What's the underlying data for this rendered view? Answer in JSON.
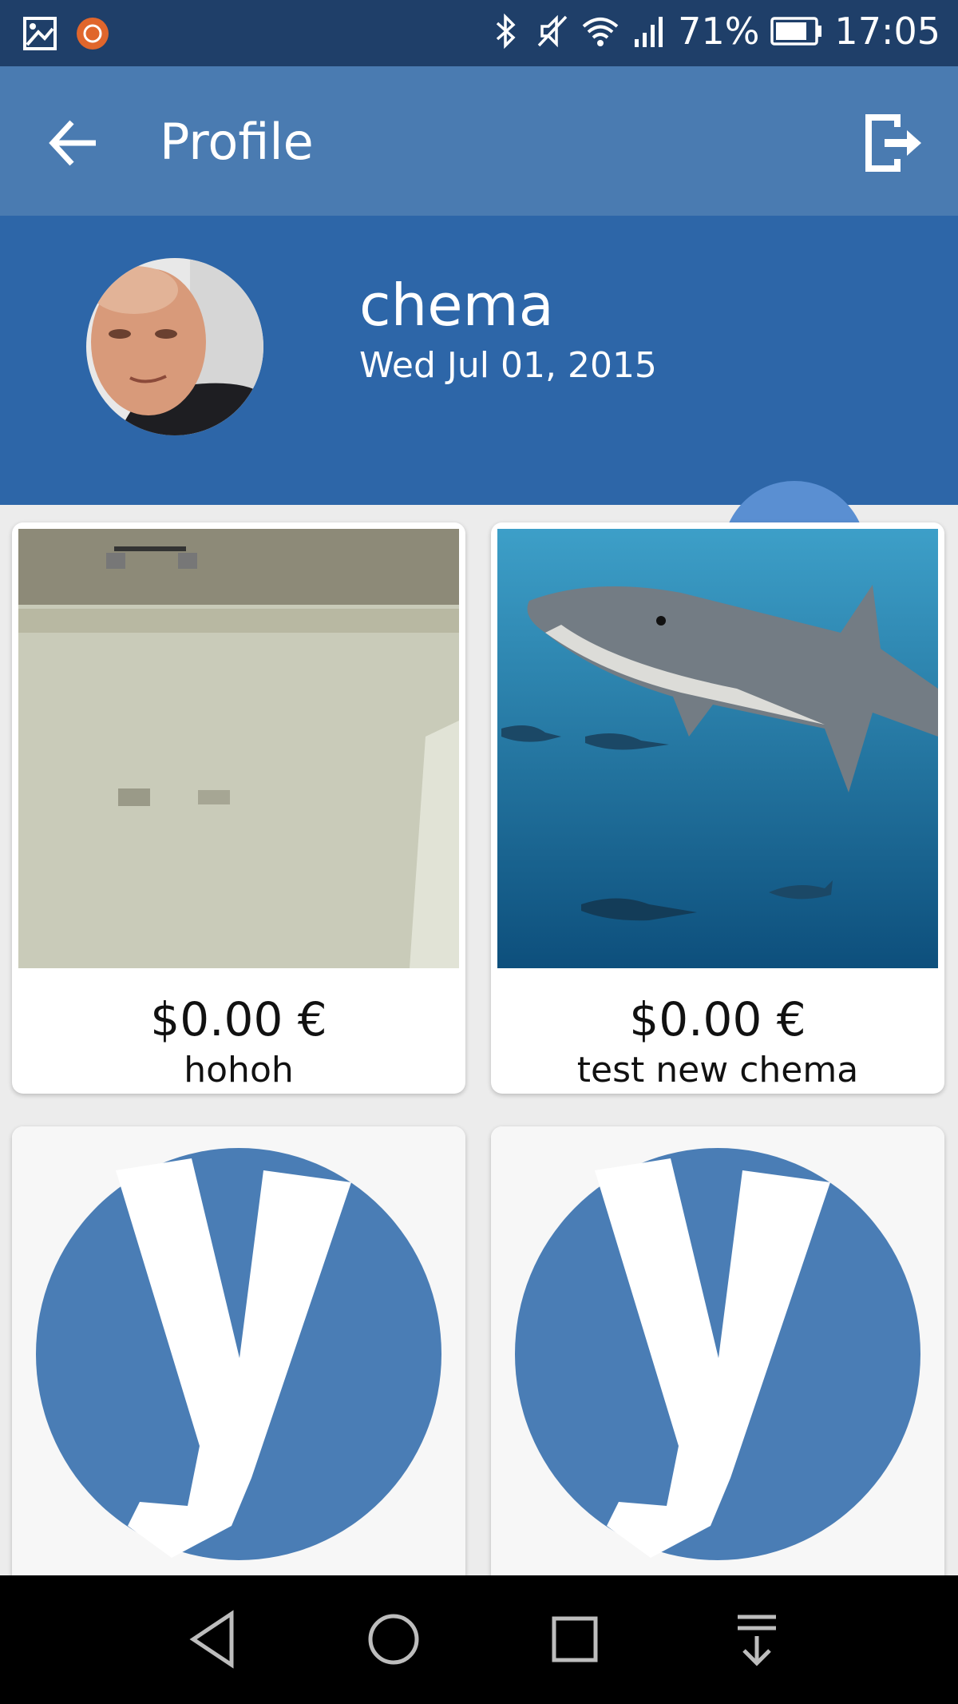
{
  "status_bar": {
    "battery": "71%",
    "time": "17:05"
  },
  "app_bar": {
    "title": "Profile"
  },
  "profile": {
    "username": "chema",
    "join_date": "Wed Jul 01, 2015"
  },
  "products": [
    {
      "price": "$0.00 €",
      "name": "hohoh",
      "image": "room-wall-photo"
    },
    {
      "price": "$0.00 €",
      "name": "test new chema",
      "image": "shark-photo"
    },
    {
      "price": "",
      "name": "",
      "image": "y-logo"
    },
    {
      "price": "",
      "name": "",
      "image": "y-logo"
    }
  ],
  "colors": {
    "status_bar": "#1f3f69",
    "app_bar": "#4a7bb1",
    "profile_header": "#2d66a8",
    "fab": "#5a8fd2",
    "logo_blue": "#4a7db5"
  },
  "nav_bar": {
    "buttons": [
      "back-icon",
      "home-icon",
      "recents-icon",
      "notification-pull-icon"
    ]
  }
}
